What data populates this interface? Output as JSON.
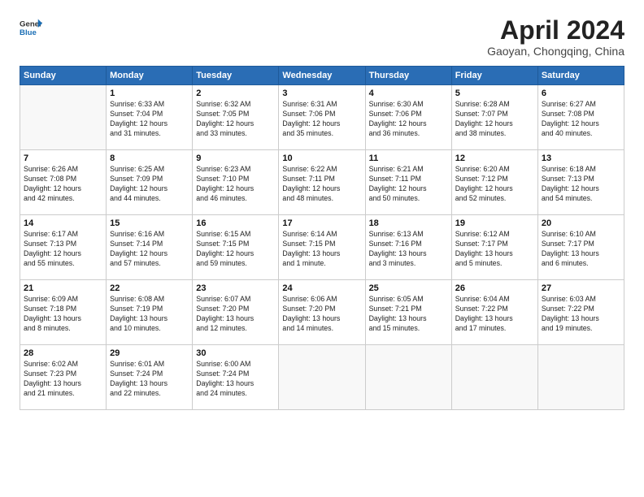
{
  "header": {
    "logo_line1": "General",
    "logo_line2": "Blue",
    "title": "April 2024",
    "location": "Gaoyan, Chongqing, China"
  },
  "columns": [
    "Sunday",
    "Monday",
    "Tuesday",
    "Wednesday",
    "Thursday",
    "Friday",
    "Saturday"
  ],
  "weeks": [
    {
      "days": [
        {
          "num": "",
          "info": []
        },
        {
          "num": "1",
          "info": [
            "Sunrise: 6:33 AM",
            "Sunset: 7:04 PM",
            "Daylight: 12 hours",
            "and 31 minutes."
          ]
        },
        {
          "num": "2",
          "info": [
            "Sunrise: 6:32 AM",
            "Sunset: 7:05 PM",
            "Daylight: 12 hours",
            "and 33 minutes."
          ]
        },
        {
          "num": "3",
          "info": [
            "Sunrise: 6:31 AM",
            "Sunset: 7:06 PM",
            "Daylight: 12 hours",
            "and 35 minutes."
          ]
        },
        {
          "num": "4",
          "info": [
            "Sunrise: 6:30 AM",
            "Sunset: 7:06 PM",
            "Daylight: 12 hours",
            "and 36 minutes."
          ]
        },
        {
          "num": "5",
          "info": [
            "Sunrise: 6:28 AM",
            "Sunset: 7:07 PM",
            "Daylight: 12 hours",
            "and 38 minutes."
          ]
        },
        {
          "num": "6",
          "info": [
            "Sunrise: 6:27 AM",
            "Sunset: 7:08 PM",
            "Daylight: 12 hours",
            "and 40 minutes."
          ]
        }
      ]
    },
    {
      "days": [
        {
          "num": "7",
          "info": [
            "Sunrise: 6:26 AM",
            "Sunset: 7:08 PM",
            "Daylight: 12 hours",
            "and 42 minutes."
          ]
        },
        {
          "num": "8",
          "info": [
            "Sunrise: 6:25 AM",
            "Sunset: 7:09 PM",
            "Daylight: 12 hours",
            "and 44 minutes."
          ]
        },
        {
          "num": "9",
          "info": [
            "Sunrise: 6:23 AM",
            "Sunset: 7:10 PM",
            "Daylight: 12 hours",
            "and 46 minutes."
          ]
        },
        {
          "num": "10",
          "info": [
            "Sunrise: 6:22 AM",
            "Sunset: 7:11 PM",
            "Daylight: 12 hours",
            "and 48 minutes."
          ]
        },
        {
          "num": "11",
          "info": [
            "Sunrise: 6:21 AM",
            "Sunset: 7:11 PM",
            "Daylight: 12 hours",
            "and 50 minutes."
          ]
        },
        {
          "num": "12",
          "info": [
            "Sunrise: 6:20 AM",
            "Sunset: 7:12 PM",
            "Daylight: 12 hours",
            "and 52 minutes."
          ]
        },
        {
          "num": "13",
          "info": [
            "Sunrise: 6:18 AM",
            "Sunset: 7:13 PM",
            "Daylight: 12 hours",
            "and 54 minutes."
          ]
        }
      ]
    },
    {
      "days": [
        {
          "num": "14",
          "info": [
            "Sunrise: 6:17 AM",
            "Sunset: 7:13 PM",
            "Daylight: 12 hours",
            "and 55 minutes."
          ]
        },
        {
          "num": "15",
          "info": [
            "Sunrise: 6:16 AM",
            "Sunset: 7:14 PM",
            "Daylight: 12 hours",
            "and 57 minutes."
          ]
        },
        {
          "num": "16",
          "info": [
            "Sunrise: 6:15 AM",
            "Sunset: 7:15 PM",
            "Daylight: 12 hours",
            "and 59 minutes."
          ]
        },
        {
          "num": "17",
          "info": [
            "Sunrise: 6:14 AM",
            "Sunset: 7:15 PM",
            "Daylight: 13 hours",
            "and 1 minute."
          ]
        },
        {
          "num": "18",
          "info": [
            "Sunrise: 6:13 AM",
            "Sunset: 7:16 PM",
            "Daylight: 13 hours",
            "and 3 minutes."
          ]
        },
        {
          "num": "19",
          "info": [
            "Sunrise: 6:12 AM",
            "Sunset: 7:17 PM",
            "Daylight: 13 hours",
            "and 5 minutes."
          ]
        },
        {
          "num": "20",
          "info": [
            "Sunrise: 6:10 AM",
            "Sunset: 7:17 PM",
            "Daylight: 13 hours",
            "and 6 minutes."
          ]
        }
      ]
    },
    {
      "days": [
        {
          "num": "21",
          "info": [
            "Sunrise: 6:09 AM",
            "Sunset: 7:18 PM",
            "Daylight: 13 hours",
            "and 8 minutes."
          ]
        },
        {
          "num": "22",
          "info": [
            "Sunrise: 6:08 AM",
            "Sunset: 7:19 PM",
            "Daylight: 13 hours",
            "and 10 minutes."
          ]
        },
        {
          "num": "23",
          "info": [
            "Sunrise: 6:07 AM",
            "Sunset: 7:20 PM",
            "Daylight: 13 hours",
            "and 12 minutes."
          ]
        },
        {
          "num": "24",
          "info": [
            "Sunrise: 6:06 AM",
            "Sunset: 7:20 PM",
            "Daylight: 13 hours",
            "and 14 minutes."
          ]
        },
        {
          "num": "25",
          "info": [
            "Sunrise: 6:05 AM",
            "Sunset: 7:21 PM",
            "Daylight: 13 hours",
            "and 15 minutes."
          ]
        },
        {
          "num": "26",
          "info": [
            "Sunrise: 6:04 AM",
            "Sunset: 7:22 PM",
            "Daylight: 13 hours",
            "and 17 minutes."
          ]
        },
        {
          "num": "27",
          "info": [
            "Sunrise: 6:03 AM",
            "Sunset: 7:22 PM",
            "Daylight: 13 hours",
            "and 19 minutes."
          ]
        }
      ]
    },
    {
      "days": [
        {
          "num": "28",
          "info": [
            "Sunrise: 6:02 AM",
            "Sunset: 7:23 PM",
            "Daylight: 13 hours",
            "and 21 minutes."
          ]
        },
        {
          "num": "29",
          "info": [
            "Sunrise: 6:01 AM",
            "Sunset: 7:24 PM",
            "Daylight: 13 hours",
            "and 22 minutes."
          ]
        },
        {
          "num": "30",
          "info": [
            "Sunrise: 6:00 AM",
            "Sunset: 7:24 PM",
            "Daylight: 13 hours",
            "and 24 minutes."
          ]
        },
        {
          "num": "",
          "info": []
        },
        {
          "num": "",
          "info": []
        },
        {
          "num": "",
          "info": []
        },
        {
          "num": "",
          "info": []
        }
      ]
    }
  ]
}
